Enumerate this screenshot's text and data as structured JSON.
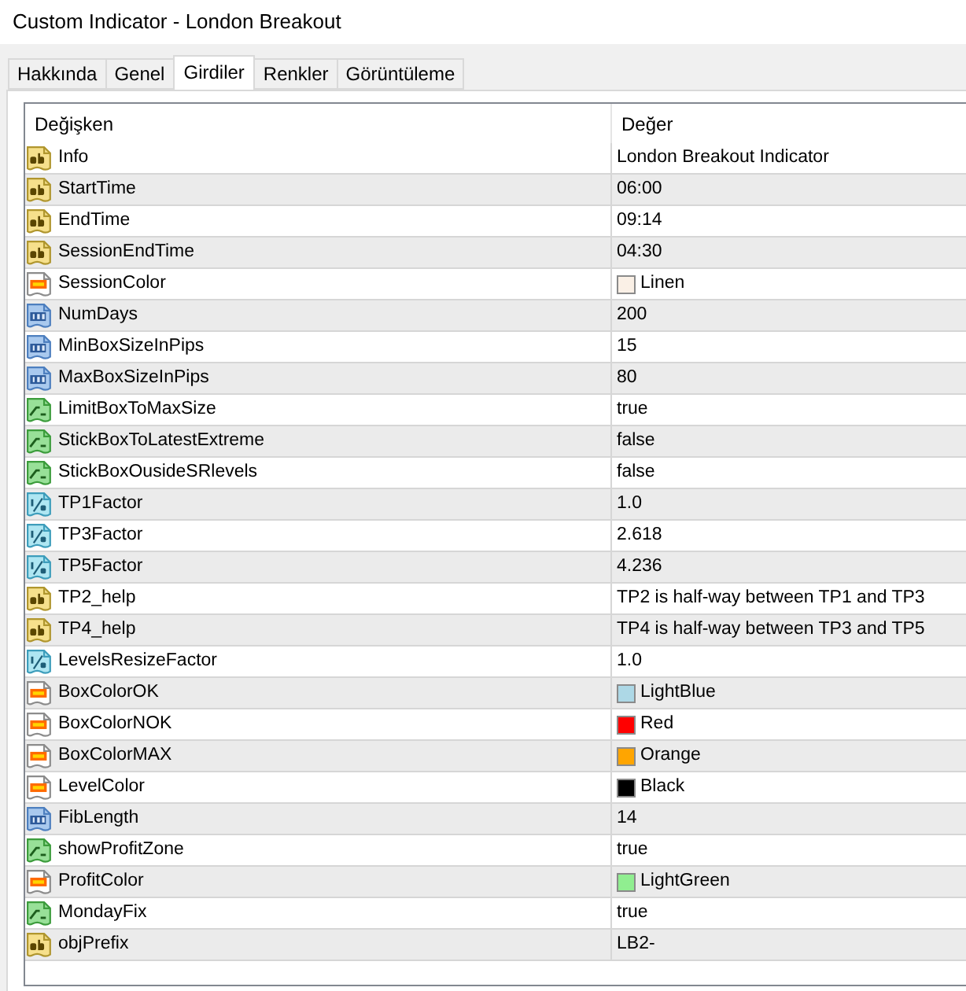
{
  "window": {
    "title": "Custom Indicator - London Breakout"
  },
  "tabs": [
    {
      "label": "Hakkında",
      "selected": false
    },
    {
      "label": "Genel",
      "selected": false
    },
    {
      "label": "Girdiler",
      "selected": true
    },
    {
      "label": "Renkler",
      "selected": false
    },
    {
      "label": "Görüntüleme",
      "selected": false
    }
  ],
  "table": {
    "columns": [
      "Değişken",
      "Değer"
    ],
    "rows": [
      {
        "kind": "string",
        "name": "Info",
        "value": "London Breakout Indicator"
      },
      {
        "kind": "string",
        "name": "StartTime",
        "value": "06:00"
      },
      {
        "kind": "string",
        "name": "EndTime",
        "value": "09:14"
      },
      {
        "kind": "string",
        "name": "SessionEndTime",
        "value": "04:30"
      },
      {
        "kind": "color",
        "name": "SessionColor",
        "value": "Linen",
        "color": "#faf0e6"
      },
      {
        "kind": "integer",
        "name": "NumDays",
        "value": "200"
      },
      {
        "kind": "integer",
        "name": "MinBoxSizeInPips",
        "value": "15"
      },
      {
        "kind": "integer",
        "name": "MaxBoxSizeInPips",
        "value": "80"
      },
      {
        "kind": "bool",
        "name": "LimitBoxToMaxSize",
        "value": "true"
      },
      {
        "kind": "bool",
        "name": "StickBoxToLatestExtreme",
        "value": "false"
      },
      {
        "kind": "bool",
        "name": "StickBoxOusideSRlevels",
        "value": "false"
      },
      {
        "kind": "double",
        "name": "TP1Factor",
        "value": "1.0"
      },
      {
        "kind": "double",
        "name": "TP3Factor",
        "value": "2.618"
      },
      {
        "kind": "double",
        "name": "TP5Factor",
        "value": "4.236"
      },
      {
        "kind": "string",
        "name": "TP2_help",
        "value": "TP2 is half-way between TP1 and TP3"
      },
      {
        "kind": "string",
        "name": "TP4_help",
        "value": "TP4 is half-way between TP3 and TP5"
      },
      {
        "kind": "double",
        "name": "LevelsResizeFactor",
        "value": "1.0"
      },
      {
        "kind": "color",
        "name": "BoxColorOK",
        "value": "LightBlue",
        "color": "#add8e6"
      },
      {
        "kind": "color",
        "name": "BoxColorNOK",
        "value": "Red",
        "color": "#ff0000"
      },
      {
        "kind": "color",
        "name": "BoxColorMAX",
        "value": "Orange",
        "color": "#ffa500"
      },
      {
        "kind": "color",
        "name": "LevelColor",
        "value": "Black",
        "color": "#000000"
      },
      {
        "kind": "integer",
        "name": "FibLength",
        "value": "14"
      },
      {
        "kind": "bool",
        "name": "showProfitZone",
        "value": "true"
      },
      {
        "kind": "color",
        "name": "ProfitColor",
        "value": "LightGreen",
        "color": "#90ee90"
      },
      {
        "kind": "bool",
        "name": "MondayFix",
        "value": "true"
      },
      {
        "kind": "string",
        "name": "objPrefix",
        "value": "LB2-"
      }
    ]
  }
}
